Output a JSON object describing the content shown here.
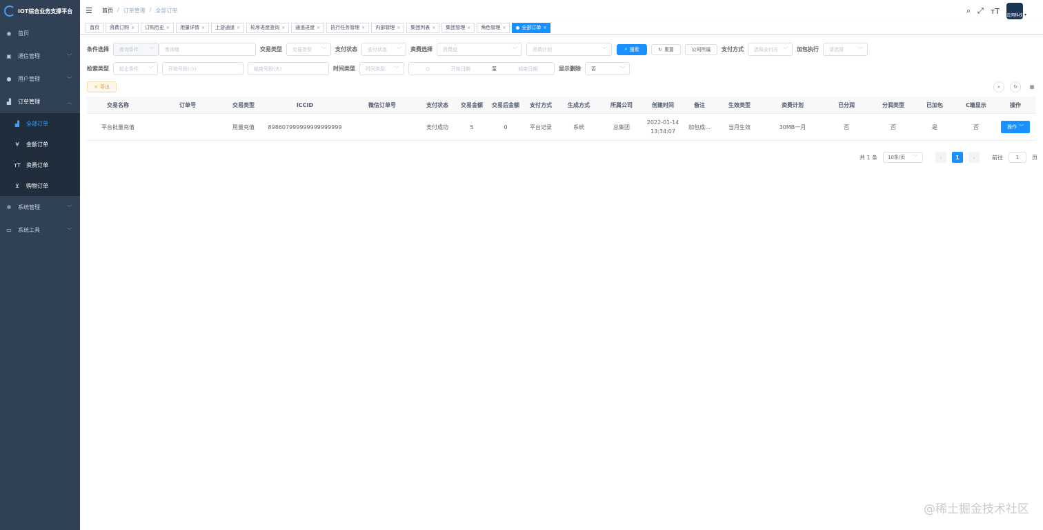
{
  "app": {
    "title": "IOT综合业务支撑平台"
  },
  "sidebar": {
    "items": [
      {
        "label": "首页",
        "icon": "dashboard-icon"
      },
      {
        "label": "通信管理",
        "icon": "monitor-icon"
      },
      {
        "label": "用户管理",
        "icon": "user-icon"
      },
      {
        "label": "订单管理",
        "icon": "chart-icon"
      },
      {
        "label": "系统管理",
        "icon": "gear-icon"
      },
      {
        "label": "系统工具",
        "icon": "toolbox-icon"
      }
    ],
    "sub_items": [
      {
        "label": "全部订单",
        "icon": "bar-chart-icon"
      },
      {
        "label": "金额订单",
        "icon": "yen-icon"
      },
      {
        "label": "资费订单",
        "icon": "font-size-icon"
      },
      {
        "label": "购物订单",
        "icon": "cart-icon"
      }
    ]
  },
  "header": {
    "breadcrumb": [
      "首页",
      "订单管理",
      "全部订单"
    ],
    "avatar_text": "云网科技"
  },
  "tags": [
    {
      "label": "首页",
      "active": false
    },
    {
      "label": "资费订购",
      "active": false
    },
    {
      "label": "订购历史",
      "active": false
    },
    {
      "label": "用量详情",
      "active": false
    },
    {
      "label": "上游通道",
      "active": false
    },
    {
      "label": "轮序进度查询",
      "active": false
    },
    {
      "label": "通道进度",
      "active": false
    },
    {
      "label": "执行任务管理",
      "active": false
    },
    {
      "label": "内部管理",
      "active": false
    },
    {
      "label": "集团列表",
      "active": false
    },
    {
      "label": "集团管理",
      "active": false
    },
    {
      "label": "角色管理",
      "active": false
    },
    {
      "label": "全部订单",
      "active": true
    }
  ],
  "filters": {
    "condition_label": "条件选择",
    "condition_placeholder": "查询条件",
    "query_placeholder": "查询值",
    "trade_type_label": "交易类型",
    "trade_type_placeholder": "交易类型",
    "pay_status_label": "支付状态",
    "pay_status_placeholder": "支付状态",
    "tariff_label": "资费选择",
    "tariff_group_placeholder": "资费组",
    "tariff_plan_placeholder": "资费计划",
    "search_btn": "搜索",
    "reset_btn": "重置",
    "company_btn": "公司所属",
    "pay_method_label": "支付方式",
    "pay_method_placeholder": "选择支付方",
    "addon_label": "加包执行",
    "addon_placeholder": "请选择",
    "search_type_label": "检索类型",
    "search_type_placeholder": "起止条件",
    "start_no_placeholder": "开始号段(小)",
    "end_no_placeholder": "结束号段(大)",
    "time_type_label": "时间类型",
    "time_type_placeholder": "时间类型",
    "start_date_placeholder": "开始日期",
    "date_sep": "至",
    "end_date_placeholder": "结束日期",
    "show_deleted_label": "显示删除",
    "show_deleted_value": "否",
    "export_btn": "导出"
  },
  "table": {
    "columns": [
      "交易名称",
      "订单号",
      "交易类型",
      "ICCID",
      "微信订单号",
      "支付状态",
      "交易金额",
      "交易后金额",
      "支付方式",
      "生成方式",
      "所属公司",
      "创建时间",
      "备注",
      "生效类型",
      "资费计划",
      "已分润",
      "分润类型",
      "已加包",
      "C端显示",
      "操作"
    ],
    "rows": [
      {
        "name": "平台批量充值",
        "order_no": "",
        "trade_type": "用量充值",
        "iccid": "898607999999999999999",
        "wx_order": "",
        "pay_status": "支付成功",
        "amount": "5",
        "after_amount": "0",
        "pay_method": "平台记录",
        "gen_method": "系统",
        "company": "总集团",
        "created_date": "2022-01-14",
        "created_time": "13:34:07",
        "remark": "加包成...",
        "effect_type": "当月生效",
        "plan": "30MB一月",
        "profit_shared": "否",
        "profit_type": "否",
        "added": "是",
        "c_show": "否",
        "op_label": "操作"
      }
    ]
  },
  "pagination": {
    "total": "共 1 条",
    "page_size": "10条/页",
    "current": "1",
    "goto_label": "前往",
    "goto_value": "1",
    "page_suffix": "页"
  },
  "watermark": "@稀土掘金技术社区"
}
